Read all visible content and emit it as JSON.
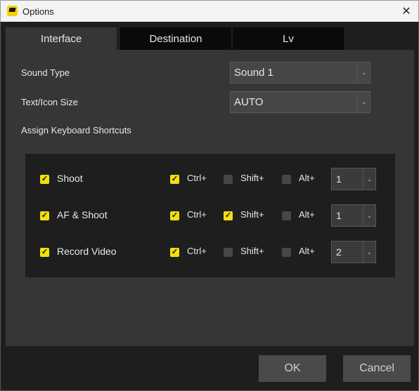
{
  "window": {
    "title": "Options",
    "close_glyph": "✕"
  },
  "tabs": [
    {
      "label": "Interface",
      "active": true
    },
    {
      "label": "Destination",
      "active": false
    },
    {
      "label": "Lv",
      "active": false
    }
  ],
  "interface": {
    "sound_type": {
      "label": "Sound Type",
      "value": "Sound 1"
    },
    "text_icon_size": {
      "label": "Text/Icon Size",
      "value": "AUTO"
    },
    "shortcuts_heading": "Assign Keyboard Shortcuts",
    "shortcuts": [
      {
        "enabled": true,
        "name": "Shoot",
        "ctrl": true,
        "shift": false,
        "alt": false,
        "key": "1"
      },
      {
        "enabled": true,
        "name": "AF & Shoot",
        "ctrl": true,
        "shift": true,
        "alt": false,
        "key": "1"
      },
      {
        "enabled": true,
        "name": "Record Video",
        "ctrl": true,
        "shift": false,
        "alt": false,
        "key": "2"
      }
    ],
    "modifier_labels": {
      "ctrl": "Ctrl+",
      "shift": "Shift+",
      "alt": "Alt+"
    }
  },
  "buttons": {
    "ok": "OK",
    "cancel": "Cancel"
  },
  "icons": {
    "checkmark": "✓",
    "dropdown_arrow": "⌄"
  },
  "colors": {
    "accent_yellow": "#f2df0d",
    "panel": "#363636",
    "background": "#1e1e1e"
  }
}
